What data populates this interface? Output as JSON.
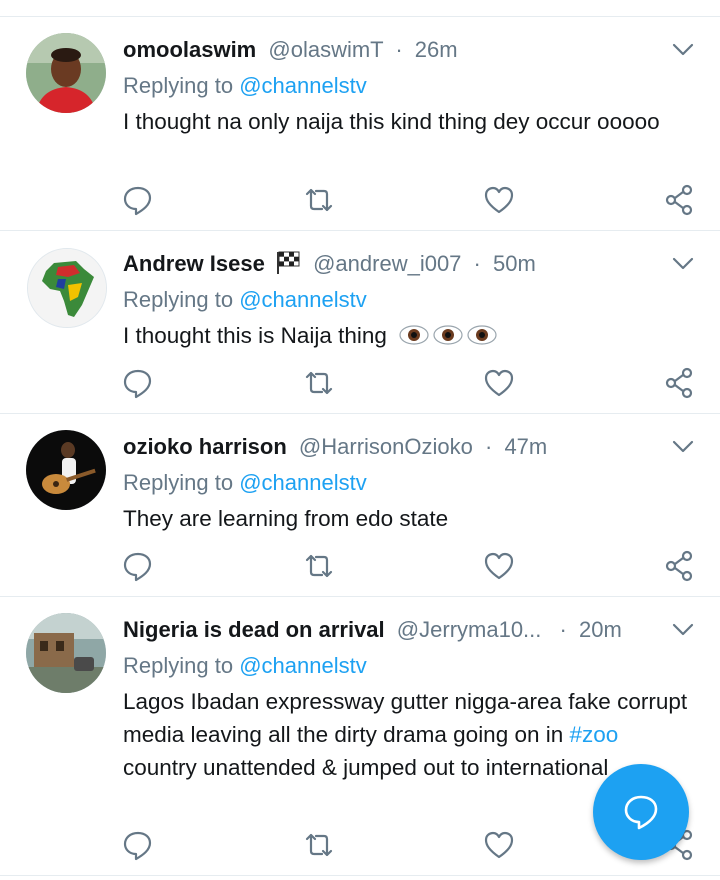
{
  "colors": {
    "accent": "#1da1f2",
    "secondary_text": "#657786",
    "divider": "#e6ecf0"
  },
  "tweets": [
    {
      "name": "omoolaswim",
      "handle": "@olaswimT",
      "separator": "·",
      "time": "26m",
      "replying_prefix": "Replying to",
      "replying_to": "@channelstv",
      "text": "I thought na only naija this kind thing dey occur ooooo",
      "avatar_icon": "avatar-man-red-shirt-icon"
    },
    {
      "name": "Andrew Isese",
      "name_emoji": "checkered-flag-icon",
      "handle": "@andrew_i007",
      "separator": "·",
      "time": "50m",
      "replying_prefix": "Replying to",
      "replying_to": "@channelstv",
      "text": "I thought this is Naija thing",
      "text_emoji": "eyes-emoji-x3",
      "avatar_icon": "avatar-africa-map-icon"
    },
    {
      "name": "ozioko harrison",
      "handle": "@HarrisonOzioko",
      "separator": "·",
      "time": "47m",
      "replying_prefix": "Replying to",
      "replying_to": "@channelstv",
      "text": "They are learning from edo state",
      "avatar_icon": "avatar-guitar-player-icon"
    },
    {
      "name": "Nigeria is dead on arrival",
      "handle": "@Jerryma10...",
      "separator": "·",
      "time": "20m",
      "replying_prefix": "Replying to",
      "replying_to": "@channelstv",
      "text_before": "Lagos Ibadan expressway gutter nigga-area fake corrupt media leaving all the dirty drama going on in ",
      "hashtag": "#zoo",
      "text_after": " country unattended & jumped out to international",
      "avatar_icon": "avatar-street-photo-icon"
    }
  ],
  "fab": {
    "icon": "compose-reply-icon"
  }
}
